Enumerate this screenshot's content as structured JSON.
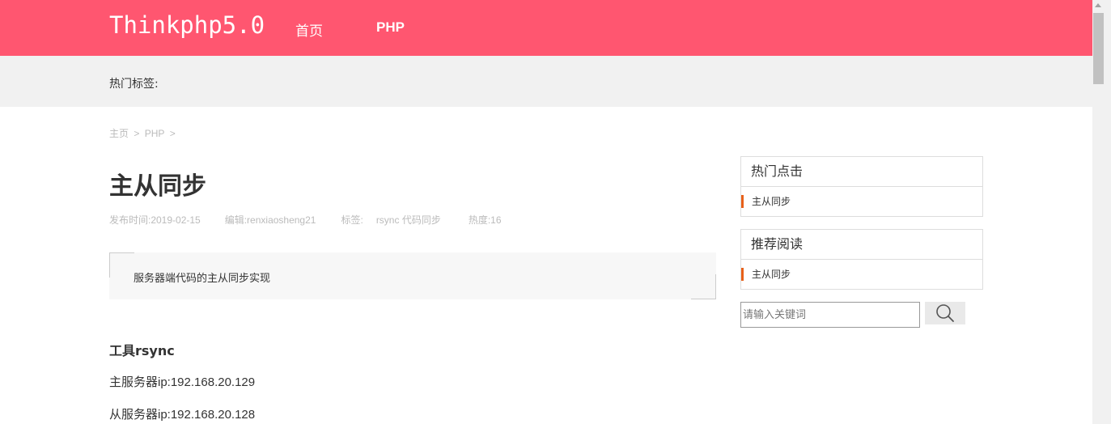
{
  "header": {
    "logo": "Thinkphp5.0",
    "nav": [
      {
        "label": "首页"
      },
      {
        "label": "PHP"
      }
    ]
  },
  "tagbar": {
    "label": "热门标签:"
  },
  "breadcrumb": {
    "home": "主页",
    "sep1": ">",
    "category": "PHP",
    "sep2": ">"
  },
  "article": {
    "title": "主从同步",
    "meta": {
      "published": "发布时间:2019-02-15",
      "editor": "编辑:renxiaosheng21",
      "tags_label": "标签:",
      "tags": "rsync 代码同步",
      "heat": "热度:16"
    },
    "summary": "服务器端代码的主从同步实现",
    "content": {
      "heading": "工具rsync",
      "lines": [
        "主服务器ip:192.168.20.129",
        "从服务器ip:192.168.20.128"
      ]
    }
  },
  "sidebar": {
    "hot": {
      "title": "热门点击",
      "items": [
        "主从同步"
      ]
    },
    "recommend": {
      "title": "推荐阅读",
      "items": [
        "主从同步"
      ]
    },
    "search": {
      "placeholder": "请输入关键词",
      "icon": "search-icon"
    }
  },
  "colors": {
    "header_bg": "#ff5670",
    "tagbar_bg": "#f1f1f1",
    "accent": "#e8611a"
  }
}
